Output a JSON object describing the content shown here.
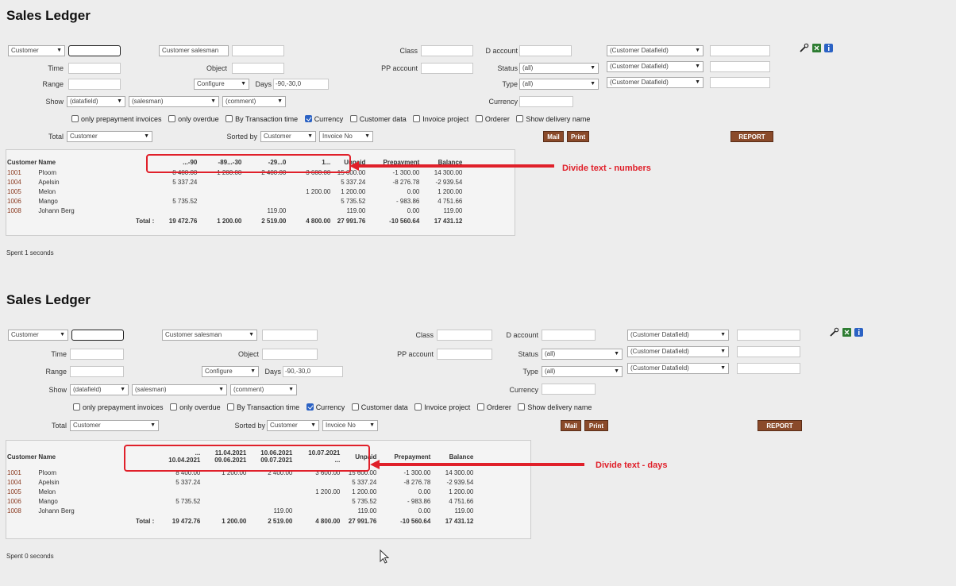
{
  "reports": [
    {
      "title": "Sales Ledger",
      "filters": {
        "customer_select": "Customer",
        "salesman_select": "Customer salesman",
        "class_label": "Class",
        "d_account_label": "D account",
        "datafield_1": "(Customer Datafield)",
        "datafield_2": "(Customer Datafield)",
        "datafield_3": "(Customer Datafield)",
        "time_label": "Time",
        "object_label": "Object",
        "pp_account_label": "PP account",
        "status_label": "Status",
        "status_value": "(all)",
        "range_label": "Range",
        "configure_select": "Configure",
        "days_label": "Days",
        "days_value": "-90,-30,0",
        "type_label": "Type",
        "type_value": "(all)",
        "show_label": "Show",
        "show_datafield": "(datafield)",
        "show_salesman": "(salesman)",
        "show_comment": "(comment)",
        "currency_label": "Currency",
        "checks": {
          "prepayment": "only prepayment invoices",
          "overdue": "only overdue",
          "transaction_time": "By Transaction time",
          "currency": "Currency",
          "customer_data": "Customer data",
          "invoice_project": "Invoice project",
          "orderer": "Orderer",
          "delivery_name": "Show delivery name"
        },
        "total_label": "Total",
        "total_value": "Customer",
        "sorted_label": "Sorted by",
        "sorted_1": "Customer",
        "sorted_2": "Invoice No",
        "mail_button": "Mail",
        "print_button": "Print",
        "report_button": "REPORT"
      },
      "table": {
        "headers": {
          "customer": "Customer",
          "name": "Name",
          "b1": "...-90",
          "b2": "-89...-30",
          "b3": "-29...0",
          "b4": "1...",
          "unpaid": "Unpaid",
          "prepayment": "Prepayment",
          "balance": "Balance"
        },
        "rows": [
          {
            "code": "1001",
            "name": "Ploom",
            "b1": "8 400.00",
            "b2": "1 200.00",
            "b3": "2 400.00",
            "b4": "3 600.00",
            "unpaid": "15 600.00",
            "prepayment": "-1 300.00",
            "balance": "14 300.00"
          },
          {
            "code": "1004",
            "name": "Apelsin",
            "b1": "5 337.24",
            "b2": "",
            "b3": "",
            "b4": "",
            "unpaid": "5 337.24",
            "prepayment": "-8 276.78",
            "balance": "-2 939.54"
          },
          {
            "code": "1005",
            "name": "Melon",
            "b1": "",
            "b2": "",
            "b3": "",
            "b4": "1 200.00",
            "unpaid": "1 200.00",
            "prepayment": "0.00",
            "balance": "1 200.00"
          },
          {
            "code": "1006",
            "name": "Mango",
            "b1": "5 735.52",
            "b2": "",
            "b3": "",
            "b4": "",
            "unpaid": "5 735.52",
            "prepayment": "- 983.86",
            "balance": "4 751.66"
          },
          {
            "code": "1008",
            "name": "Johann Berg",
            "b1": "",
            "b2": "",
            "b3": "119.00",
            "b4": "",
            "unpaid": "119.00",
            "prepayment": "0.00",
            "balance": "119.00"
          }
        ],
        "total": {
          "label": "Total :",
          "b1": "19 472.76",
          "b2": "1 200.00",
          "b3": "2 519.00",
          "b4": "4 800.00",
          "unpaid": "27 991.76",
          "prepayment": "-10 560.64",
          "balance": "17 431.12"
        }
      },
      "spent": "Spent 1 seconds",
      "annotation": "Divide text - numbers"
    },
    {
      "title": "Sales Ledger",
      "filters": {
        "customer_select": "Customer",
        "salesman_select": "Customer salesman",
        "class_label": "Class",
        "d_account_label": "D account",
        "datafield_1": "(Customer Datafield)",
        "datafield_2": "(Customer Datafield)",
        "datafield_3": "(Customer Datafield)",
        "time_label": "Time",
        "object_label": "Object",
        "pp_account_label": "PP account",
        "status_label": "Status",
        "status_value": "(all)",
        "range_label": "Range",
        "configure_select": "Configure",
        "days_label": "Days",
        "days_value": "-90,-30,0",
        "type_label": "Type",
        "type_value": "(all)",
        "show_label": "Show",
        "show_datafield": "(datafield)",
        "show_salesman": "(salesman)",
        "show_comment": "(comment)",
        "currency_label": "Currency",
        "checks": {
          "prepayment": "only prepayment invoices",
          "overdue": "only overdue",
          "transaction_time": "By Transaction time",
          "currency": "Currency",
          "customer_data": "Customer data",
          "invoice_project": "Invoice project",
          "orderer": "Orderer",
          "delivery_name": "Show delivery name"
        },
        "total_label": "Total",
        "total_value": "Customer",
        "sorted_label": "Sorted by",
        "sorted_1": "Customer",
        "sorted_2": "Invoice No",
        "mail_button": "Mail",
        "print_button": "Print",
        "report_button": "REPORT"
      },
      "table": {
        "headers": {
          "customer": "Customer",
          "name": "Name",
          "b1_top": "...",
          "b1_bottom": "10.04.2021",
          "b2_top": "11.04.2021",
          "b2_bottom": "09.06.2021",
          "b3_top": "10.06.2021",
          "b3_bottom": "09.07.2021",
          "b4_top": "10.07.2021",
          "b4_bottom": "...",
          "unpaid": "Unpaid",
          "prepayment": "Prepayment",
          "balance": "Balance"
        },
        "rows": [
          {
            "code": "1001",
            "name": "Ploom",
            "b1": "8 400.00",
            "b2": "1 200.00",
            "b3": "2 400.00",
            "b4": "3 600.00",
            "unpaid": "15 600.00",
            "prepayment": "-1 300.00",
            "balance": "14 300.00"
          },
          {
            "code": "1004",
            "name": "Apelsin",
            "b1": "5 337.24",
            "b2": "",
            "b3": "",
            "b4": "",
            "unpaid": "5 337.24",
            "prepayment": "-8 276.78",
            "balance": "-2 939.54"
          },
          {
            "code": "1005",
            "name": "Melon",
            "b1": "",
            "b2": "",
            "b3": "",
            "b4": "1 200.00",
            "unpaid": "1 200.00",
            "prepayment": "0.00",
            "balance": "1 200.00"
          },
          {
            "code": "1006",
            "name": "Mango",
            "b1": "5 735.52",
            "b2": "",
            "b3": "",
            "b4": "",
            "unpaid": "5 735.52",
            "prepayment": "- 983.86",
            "balance": "4 751.66"
          },
          {
            "code": "1008",
            "name": "Johann Berg",
            "b1": "",
            "b2": "",
            "b3": "119.00",
            "b4": "",
            "unpaid": "119.00",
            "prepayment": "0.00",
            "balance": "119.00"
          }
        ],
        "total": {
          "label": "Total :",
          "b1": "19 472.76",
          "b2": "1 200.00",
          "b3": "2 519.00",
          "b4": "4 800.00",
          "unpaid": "27 991.76",
          "prepayment": "-10 560.64",
          "balance": "17 431.12"
        }
      },
      "spent": "Spent 0 seconds",
      "annotation": "Divide text - days"
    }
  ],
  "colors": {
    "accent_button": "#8a4a2a",
    "callout": "#e0202a",
    "link": "#8a3a20"
  },
  "icons": [
    "wrench-icon",
    "excel-icon",
    "info-icon"
  ]
}
